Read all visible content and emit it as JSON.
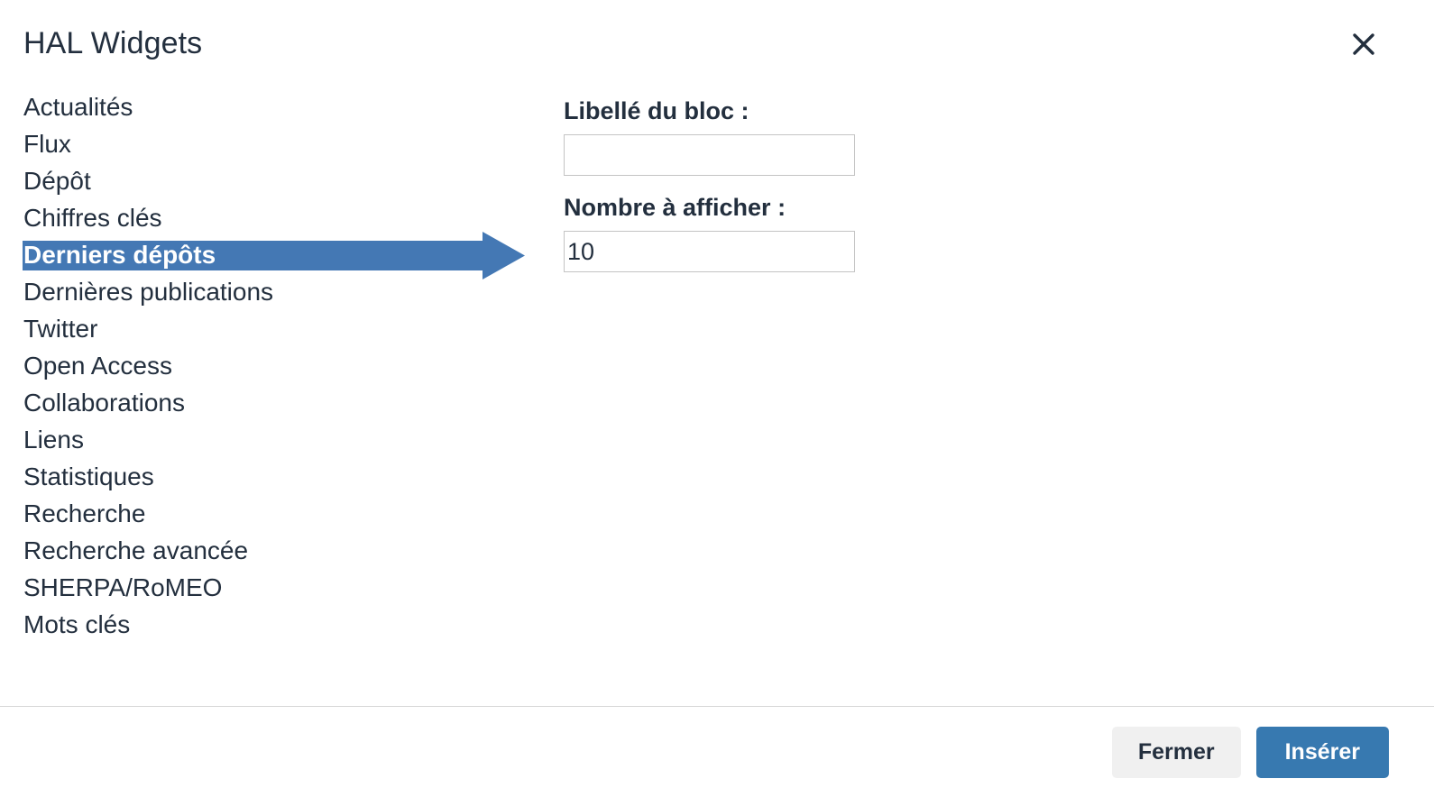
{
  "dialog": {
    "title": "HAL Widgets",
    "close_icon": "close-icon",
    "close_label": "×"
  },
  "widget_list": {
    "selected_index": 4,
    "items": [
      {
        "label": "Actualités"
      },
      {
        "label": "Flux"
      },
      {
        "label": "Dépôt"
      },
      {
        "label": "Chiffres clés"
      },
      {
        "label": "Derniers dépôts"
      },
      {
        "label": "Dernières publications"
      },
      {
        "label": "Twitter"
      },
      {
        "label": "Open Access"
      },
      {
        "label": "Collaborations"
      },
      {
        "label": "Liens"
      },
      {
        "label": "Statistiques"
      },
      {
        "label": "Recherche"
      },
      {
        "label": "Recherche avancée"
      },
      {
        "label": "SHERPA/RoMEO"
      },
      {
        "label": "Mots clés"
      }
    ]
  },
  "settings": {
    "block_label": {
      "label": "Libellé du bloc :",
      "value": "",
      "placeholder": ""
    },
    "display_count": {
      "label": "Nombre à afficher :",
      "value": "10",
      "placeholder": ""
    }
  },
  "footer": {
    "close_button": "Fermer",
    "insert_button": "Insérer"
  },
  "colors": {
    "accent_blue": "#4478b4",
    "primary_button": "#3779b0",
    "text": "#232f3e",
    "border": "#c4c4c4",
    "divider": "#d6d6d6",
    "secondary_button": "#f0f0f0"
  }
}
